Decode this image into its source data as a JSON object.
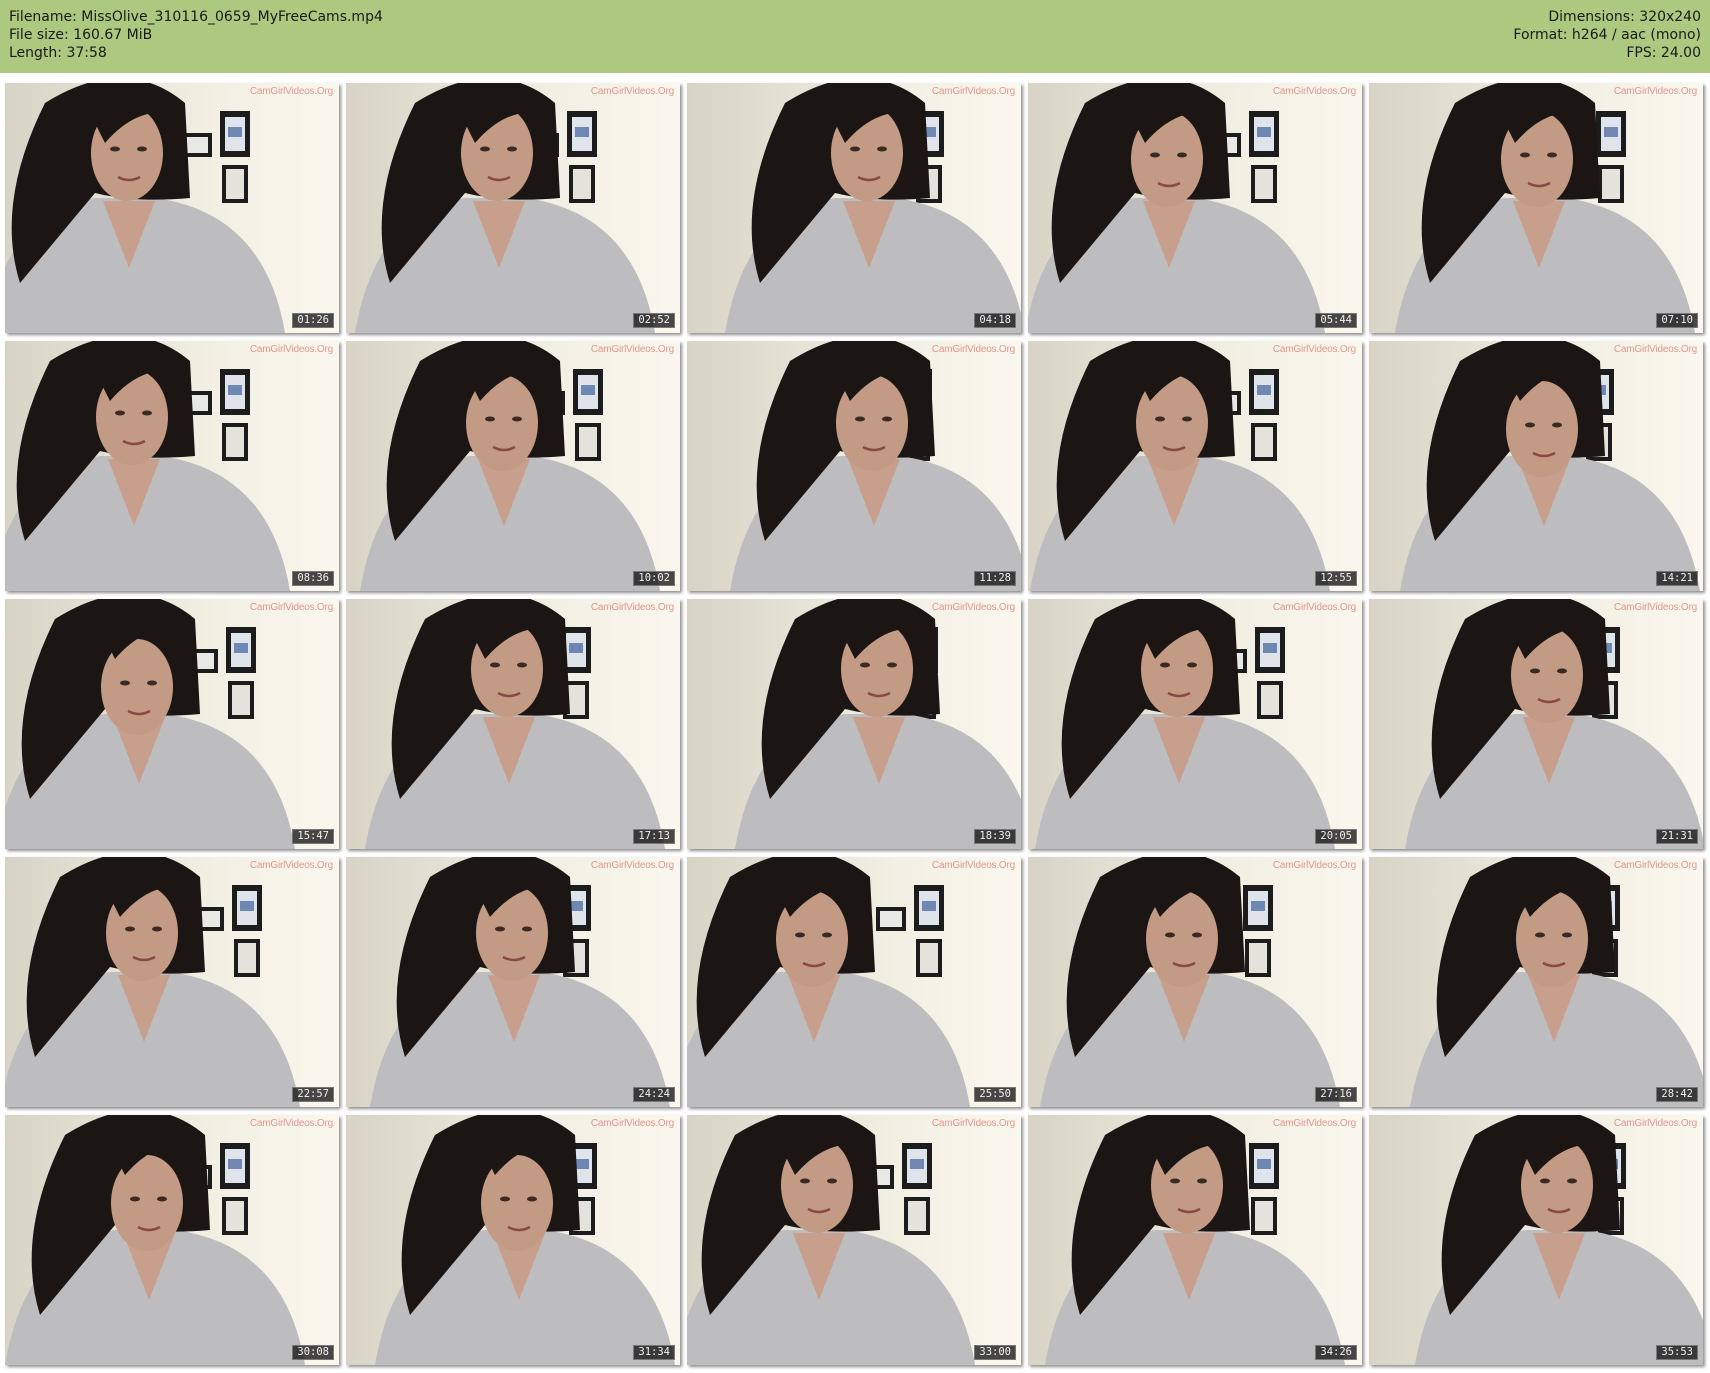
{
  "header": {
    "filename": "Filename: MissOlive_310116_0659_MyFreeCams.mp4",
    "filesize": "File size: 160.67 MiB",
    "length": "Length: 37:58",
    "dimensions": "Dimensions: 320x240",
    "format": "Format: h264 / aac (mono)",
    "fps": "FPS: 24.00",
    "background_color": "#acc97f"
  },
  "thumbnails": {
    "watermark": "CamGirlVideos.Org",
    "timestamps": [
      "01:26",
      "02:52",
      "04:18",
      "05:44",
      "07:10",
      "08:36",
      "10:02",
      "11:28",
      "12:55",
      "14:21",
      "15:47",
      "17:13",
      "18:39",
      "20:05",
      "21:31",
      "22:57",
      "24:24",
      "25:50",
      "27:16",
      "28:42",
      "30:08",
      "31:34",
      "33:00",
      "34:26",
      "35:53"
    ]
  }
}
